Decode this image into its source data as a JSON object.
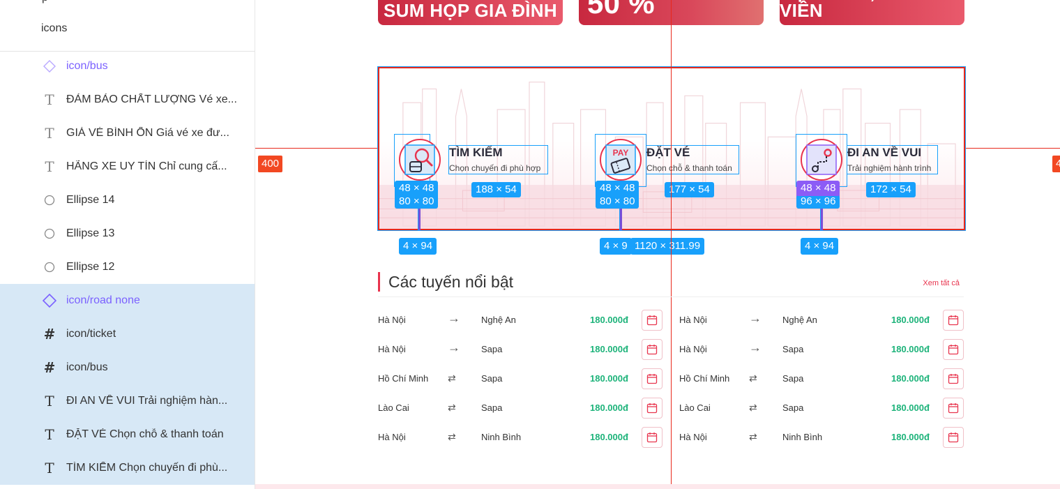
{
  "layers": {
    "top_partial": "p",
    "header": "icons",
    "items": [
      {
        "name": "icon/bus",
        "kind": "component",
        "selected": false
      },
      {
        "name": "ĐẢM BẢO CHẤT LƯỢNG Vé xe...",
        "kind": "text",
        "selected": false
      },
      {
        "name": "GIÁ VÉ BÌNH ỔN Giá vé xe đư...",
        "kind": "text",
        "selected": false
      },
      {
        "name": "HÃNG XE UY TÍN Chỉ cung cấ...",
        "kind": "text",
        "selected": false
      },
      {
        "name": "Ellipse 14",
        "kind": "ellipse",
        "selected": false
      },
      {
        "name": "Ellipse 13",
        "kind": "ellipse",
        "selected": false
      },
      {
        "name": "Ellipse 12",
        "kind": "ellipse",
        "selected": false
      },
      {
        "name": "icon/road none",
        "kind": "component",
        "selected": true
      },
      {
        "name": "icon/ticket",
        "kind": "frame",
        "selected": true
      },
      {
        "name": "icon/bus",
        "kind": "frame",
        "selected": true
      },
      {
        "name": "ĐI AN VỀ VUI Trải nghiệm hàn...",
        "kind": "text",
        "selected": true
      },
      {
        "name": "ĐẶT VÉ Chọn chỗ & thanh toán",
        "kind": "text",
        "selected": true
      },
      {
        "name": "TÌM KIẾM Chọn chuyến đi phù...",
        "kind": "text",
        "selected": true
      }
    ]
  },
  "banners": [
    {
      "text": "SUM HỌP GIA ĐÌNH"
    },
    {
      "text": "50 %"
    },
    {
      "text": "HỌC SINH, SINH VIÊN"
    }
  ],
  "guides": {
    "left_badge": "400",
    "right_badge": "4"
  },
  "features": [
    {
      "title": "TÌM KIẾM",
      "subtitle": "Chọn chuyến đi phù hợp",
      "icon": "bus-search-icon",
      "icon_dim": "48 × 48",
      "icon_dim_under": "80 × 80",
      "text_dim": "188 × 54",
      "stem_dim": "4 × 94"
    },
    {
      "title": "ĐẶT VÉ",
      "subtitle": "Chọn chỗ & thanh toán",
      "icon": "ticket-pay-icon",
      "icon_dim": "48 × 48",
      "icon_dim_under": "80 × 80",
      "text_dim": "177 × 54",
      "stem_dim": "4 × 9"
    },
    {
      "title": "ĐI AN VỀ VUI",
      "subtitle": "Trải nghiệm hành trình",
      "icon": "road-route-icon",
      "icon_dim": "48 × 48",
      "icon_dim_under": "96 × 96",
      "text_dim": "172 × 54",
      "stem_dim": "4 × 94"
    }
  ],
  "frame_dim": "1120 × 311.99",
  "routes": {
    "title": "Các tuyến nổi bật",
    "see_all": "Xem tất cả",
    "left": [
      {
        "from": "Hà Nội",
        "to": "Nghệ An",
        "price": "180.000đ",
        "arrow": "one-way"
      },
      {
        "from": "Hà Nội",
        "to": "Sapa",
        "price": "180.000đ",
        "arrow": "one-way"
      },
      {
        "from": "Hồ Chí Minh",
        "to": "Sapa",
        "price": "180.000đ",
        "arrow": "round-trip"
      },
      {
        "from": "Lào Cai",
        "to": "Sapa",
        "price": "180.000đ",
        "arrow": "round-trip"
      },
      {
        "from": "Hà Nội",
        "to": "Ninh Bình",
        "price": "180.000đ",
        "arrow": "round-trip"
      }
    ],
    "right": [
      {
        "from": "Hà Nội",
        "to": "Nghệ An",
        "price": "180.000đ",
        "arrow": "one-way"
      },
      {
        "from": "Hà Nội",
        "to": "Sapa",
        "price": "180.000đ",
        "arrow": "one-way"
      },
      {
        "from": "Hồ Chí Minh",
        "to": "Sapa",
        "price": "180.000đ",
        "arrow": "round-trip"
      },
      {
        "from": "Lào Cai",
        "to": "Sapa",
        "price": "180.000đ",
        "arrow": "round-trip"
      },
      {
        "from": "Hà Nội",
        "to": "Ninh Bình",
        "price": "180.000đ",
        "arrow": "round-trip"
      }
    ]
  },
  "colors": {
    "accent": "#e8344e",
    "price": "#1db37a",
    "selection": "#18a0fb",
    "guide": "#e8291c",
    "component": "#7b61ff"
  }
}
